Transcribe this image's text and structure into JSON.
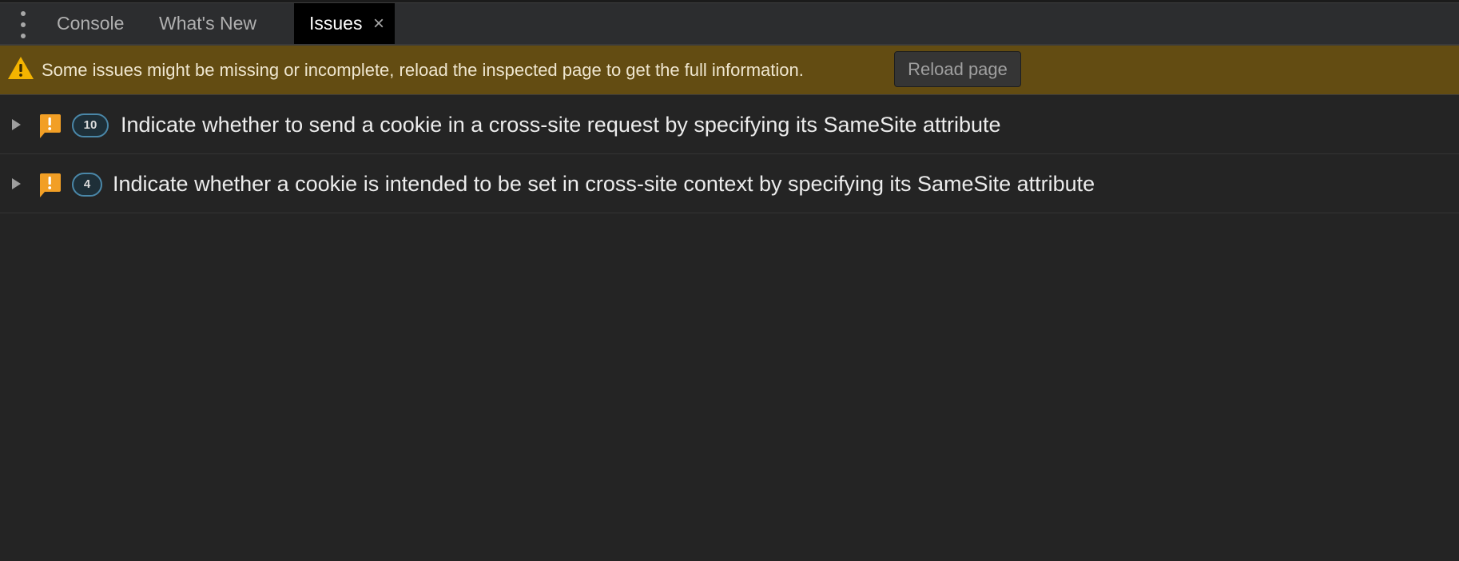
{
  "tabs": [
    {
      "label": "Console",
      "active": false
    },
    {
      "label": "What's New",
      "active": false
    },
    {
      "label": "Issues",
      "active": true,
      "close_glyph": "×"
    }
  ],
  "warning": {
    "icon": "warning-triangle-icon",
    "message": "Some issues might be missing or incomplete, reload the inspected page to get the full information.",
    "reload_label": "Reload page"
  },
  "issues": [
    {
      "icon": "issue-warning-icon",
      "count": "10",
      "title": "Indicate whether to send a cookie in a cross-site request by specifying its SameSite attribute",
      "expanded": false
    },
    {
      "icon": "issue-warning-icon",
      "count": "4",
      "title": "Indicate whether a cookie is intended to be set in cross-site context by specifying its SameSite attribute",
      "expanded": false
    }
  ],
  "colors": {
    "background": "#242424",
    "tabbar": "#2c2d2f",
    "active_tab": "#000000",
    "warning_bar": "#634c12",
    "warning_icon": "#f4b400",
    "issue_icon": "#f29f25",
    "badge_border": "#4a87a8"
  }
}
